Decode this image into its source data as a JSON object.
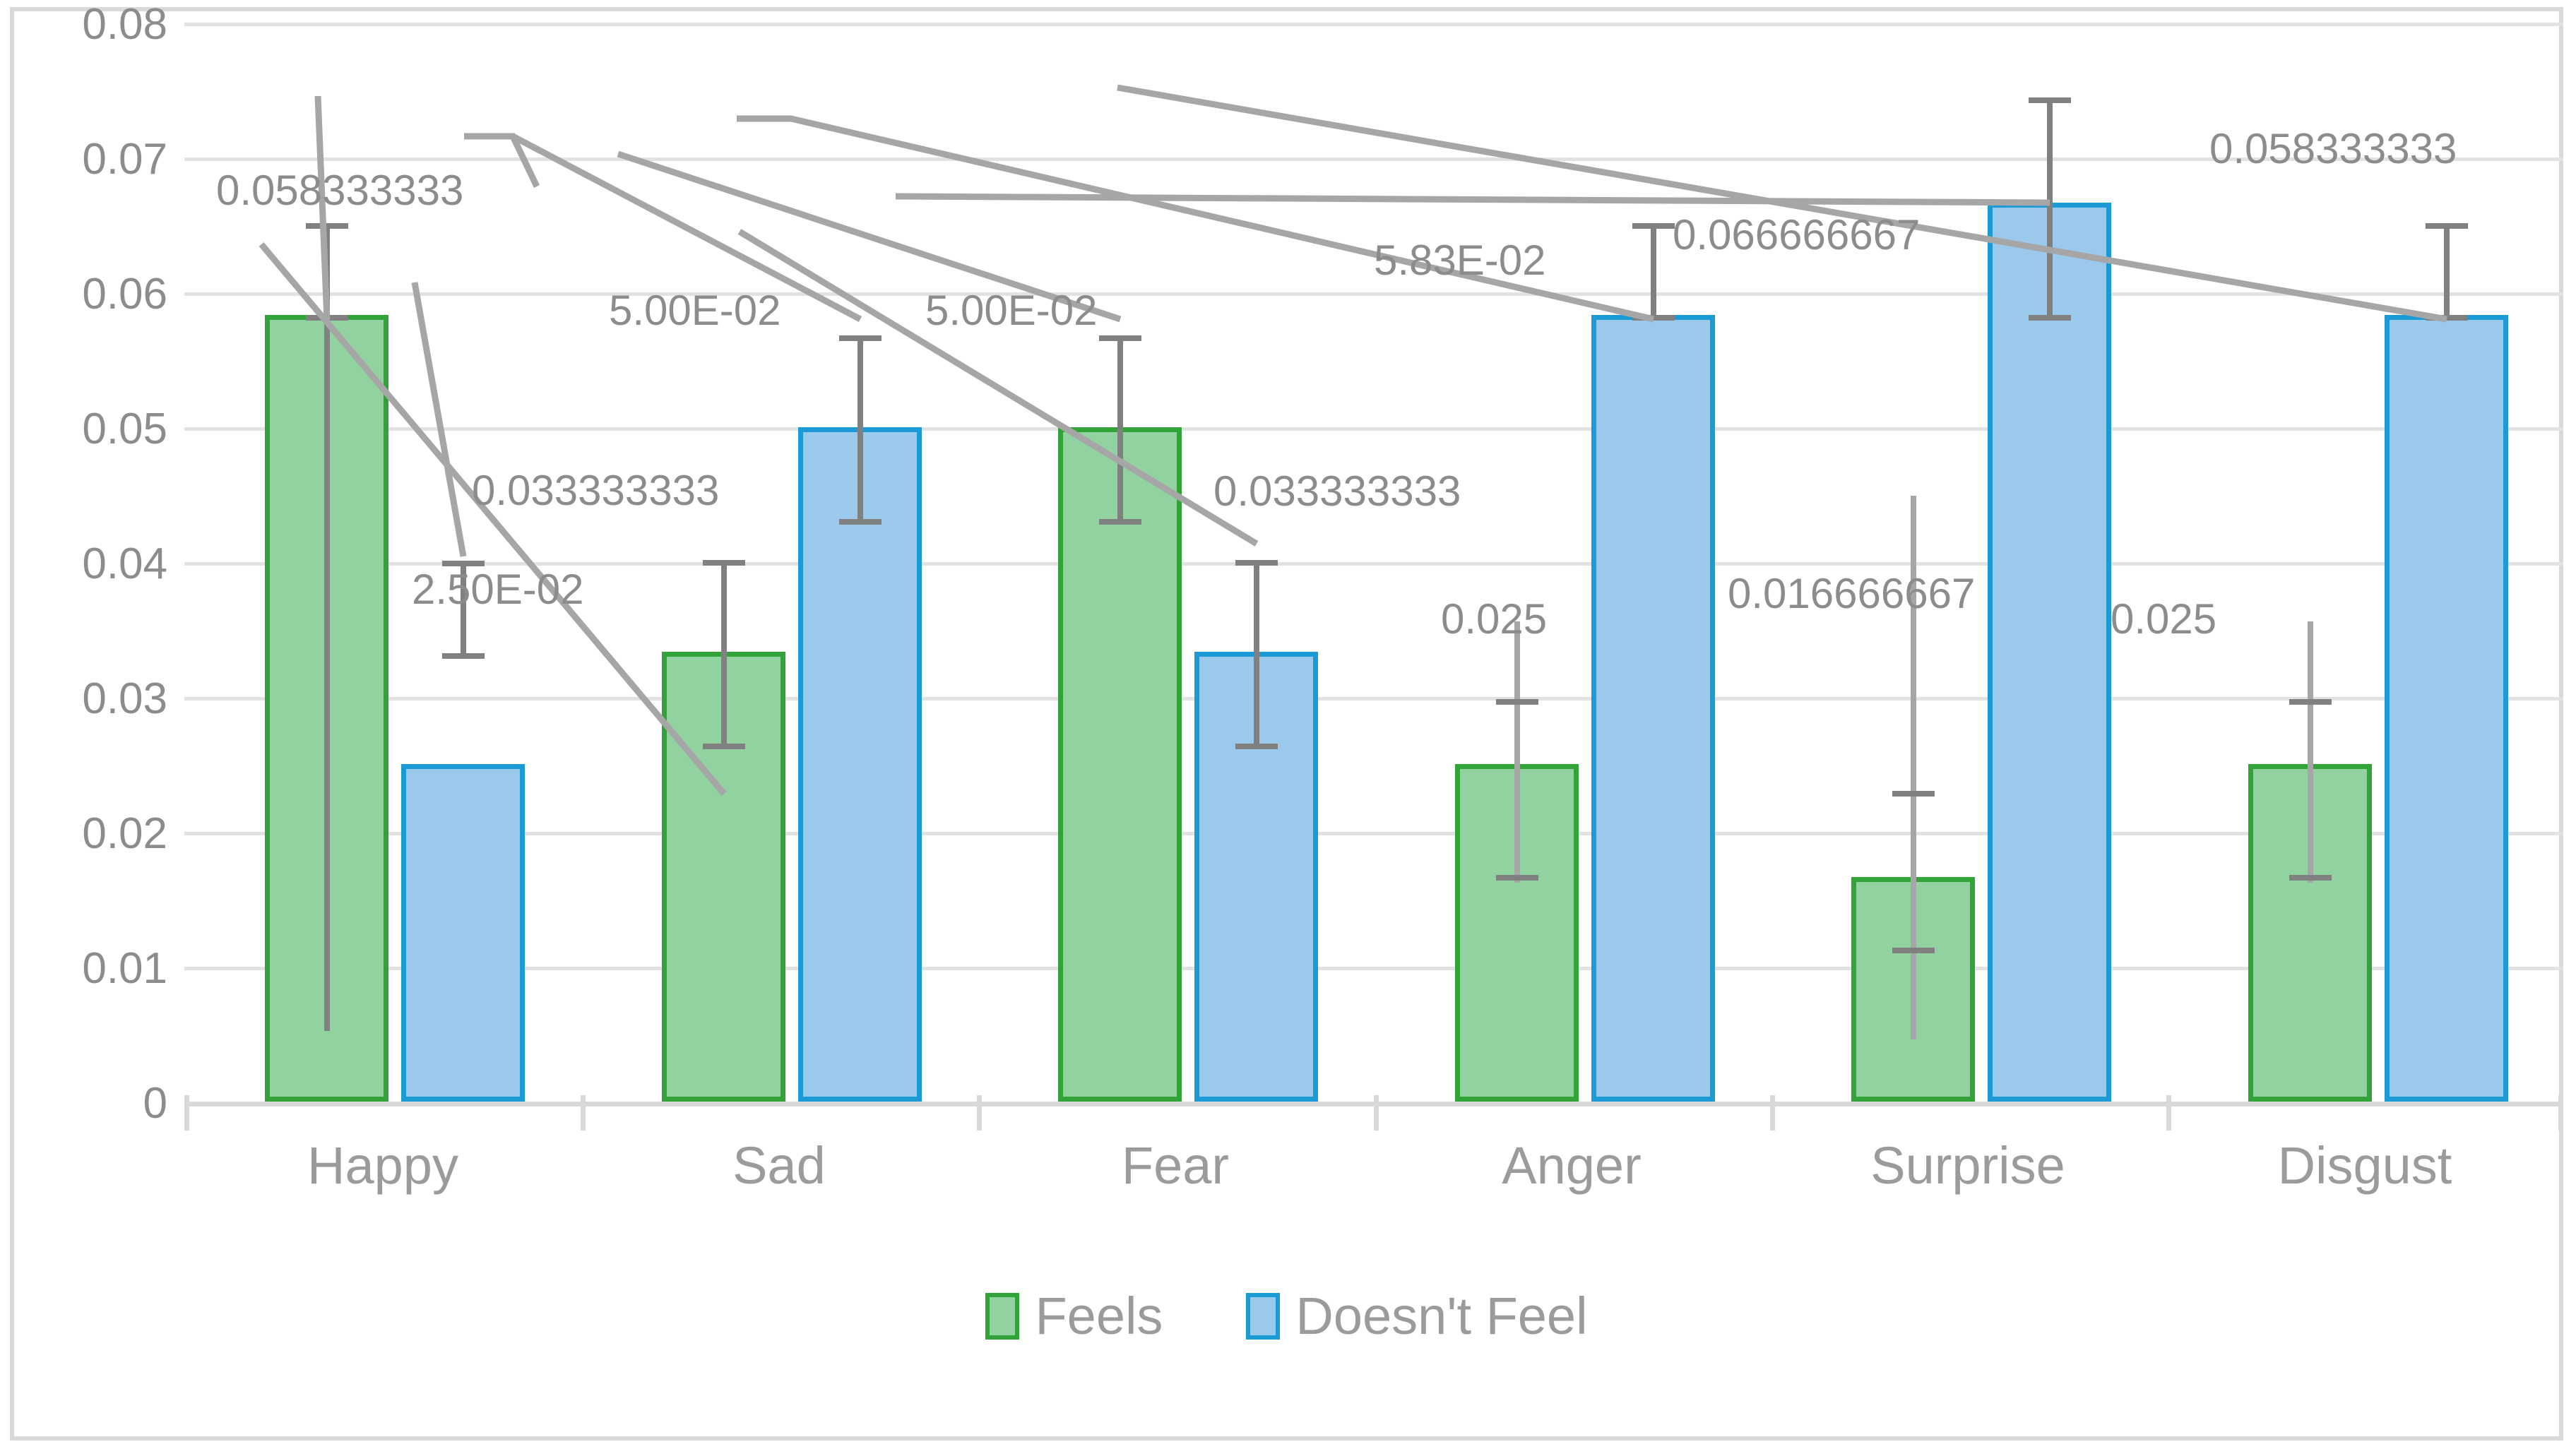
{
  "chart_data": {
    "type": "bar",
    "title": "",
    "xlabel": "",
    "ylabel": "",
    "ylim": [
      0,
      0.08
    ],
    "grid": true,
    "legend_position": "bottom",
    "categories": [
      "Happy",
      "Sad",
      "Fear",
      "Anger",
      "Surprise",
      "Disgust"
    ],
    "y_ticks": [
      "0",
      "0.01",
      "0.02",
      "0.03",
      "0.04",
      "0.05",
      "0.06",
      "0.07",
      "0.08"
    ],
    "y_tick_values": [
      0,
      0.01,
      0.02,
      0.03,
      0.04,
      0.05,
      0.06,
      0.07,
      0.08
    ],
    "series": [
      {
        "name": "Feels",
        "color": "#92d2a0",
        "border_color": "#31a338",
        "values": [
          0.058333333,
          0.033333333,
          0.05,
          0.025,
          0.016666667,
          0.025
        ],
        "value_labels": [
          "0.058333333",
          "0.033333333",
          "5.00E-02",
          "0.025",
          "0.016666667",
          "0.025"
        ],
        "error_upper": [
          0.0068,
          0.0068,
          0.0068,
          0.0068,
          0.0068,
          0.0068
        ],
        "error_lower": [
          0.0068,
          0.0068,
          0.0068,
          0.0068,
          0.0068,
          0.0068
        ]
      },
      {
        "name": "Doesn't Feel",
        "color": "#9ac9ec",
        "border_color": "#1c9ad6",
        "values": [
          0.025,
          0.05,
          0.033333333,
          0.058333333,
          0.066666667,
          0.058333333
        ],
        "value_labels": [
          "2.50E-02",
          "5.00E-02",
          "0.033333333",
          "5.83E-02",
          "0.066666667",
          "0.058333333"
        ],
        "error_upper": [
          0.0068,
          0.0068,
          0.0068,
          0.0068,
          0.0068,
          0.0068
        ],
        "error_lower": [
          0.0068,
          0.0068,
          0.0068,
          0.0068,
          0.0068,
          0.0068
        ]
      }
    ]
  },
  "axis": {
    "y_ticks": [
      "0.08",
      "0.07",
      "0.06",
      "0.05",
      "0.04",
      "0.03",
      "0.02",
      "0.01",
      "0"
    ],
    "categories": [
      "Happy",
      "Sad",
      "Fear",
      "Anger",
      "Surprise",
      "Disgust"
    ]
  },
  "data_labels": [
    "0.058333333",
    "2.50E-02",
    "5.00E-02",
    "0.033333333",
    "5.00E-02",
    "0.033333333",
    "5.83E-02",
    "0.025",
    "0.066666667",
    "0.016666667",
    "0.058333333",
    "0.025"
  ],
  "legend": {
    "items": [
      {
        "label": "Feels",
        "color": "#92d2a0"
      },
      {
        "label": "Doesn't Feel",
        "color": "#9ac9ec"
      }
    ]
  },
  "colors": {
    "feels_fill": "#92d2a0",
    "feels_border": "#31a338",
    "nofeels_fill": "#9ac9ec",
    "nofeels_border": "#1c9ad6",
    "gridline": "#e2e2e2",
    "text": "#8c8c8c",
    "frame": "#d9d9d9",
    "error_bar": "#808080"
  }
}
